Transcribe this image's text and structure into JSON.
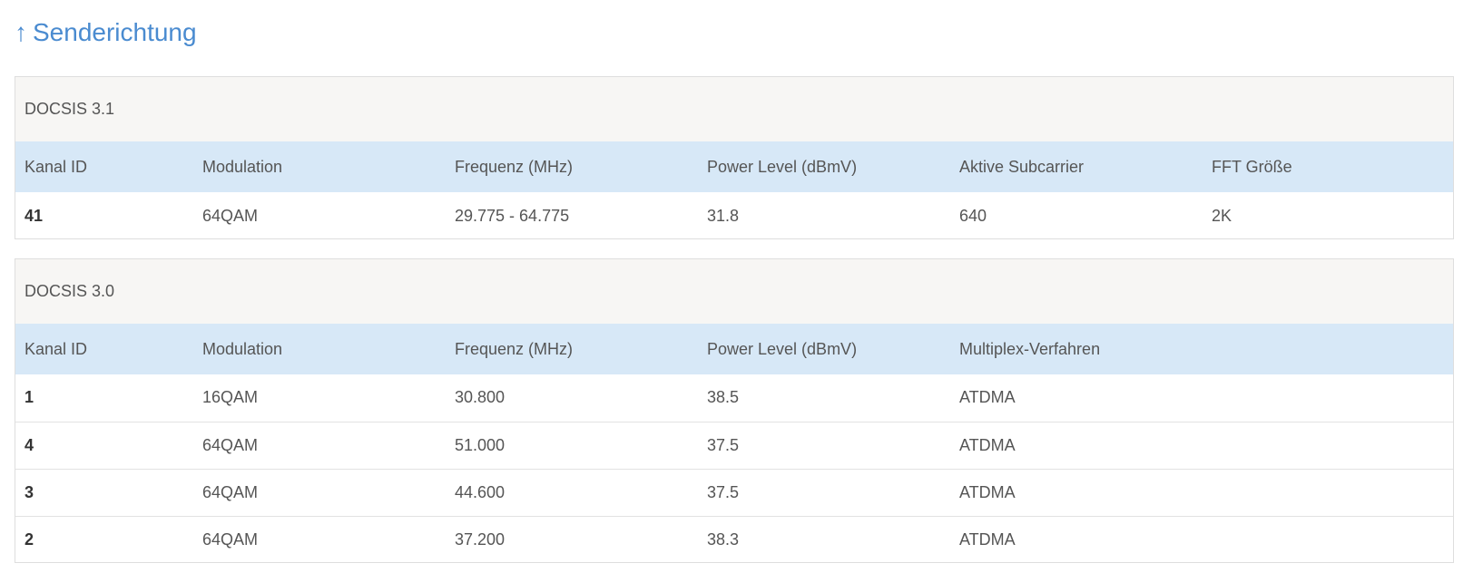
{
  "page": {
    "title_arrow": "↑",
    "title": "Senderichtung"
  },
  "docsis31": {
    "heading": "DOCSIS 3.1",
    "columns": [
      "Kanal ID",
      "Modulation",
      "Frequenz (MHz)",
      "Power Level (dBmV)",
      "Aktive Subcarrier",
      "FFT Größe"
    ],
    "rows": [
      [
        "41",
        "64QAM",
        "29.775 - 64.775",
        "31.8",
        "640",
        "2K"
      ]
    ]
  },
  "docsis30": {
    "heading": "DOCSIS 3.0",
    "columns": [
      "Kanal ID",
      "Modulation",
      "Frequenz (MHz)",
      "Power Level (dBmV)",
      "Multiplex-Verfahren"
    ],
    "rows": [
      [
        "1",
        "16QAM",
        "30.800",
        "38.5",
        "ATDMA"
      ],
      [
        "4",
        "64QAM",
        "51.000",
        "37.5",
        "ATDMA"
      ],
      [
        "3",
        "64QAM",
        "44.600",
        "37.5",
        "ATDMA"
      ],
      [
        "2",
        "64QAM",
        "37.200",
        "38.3",
        "ATDMA"
      ]
    ]
  }
}
